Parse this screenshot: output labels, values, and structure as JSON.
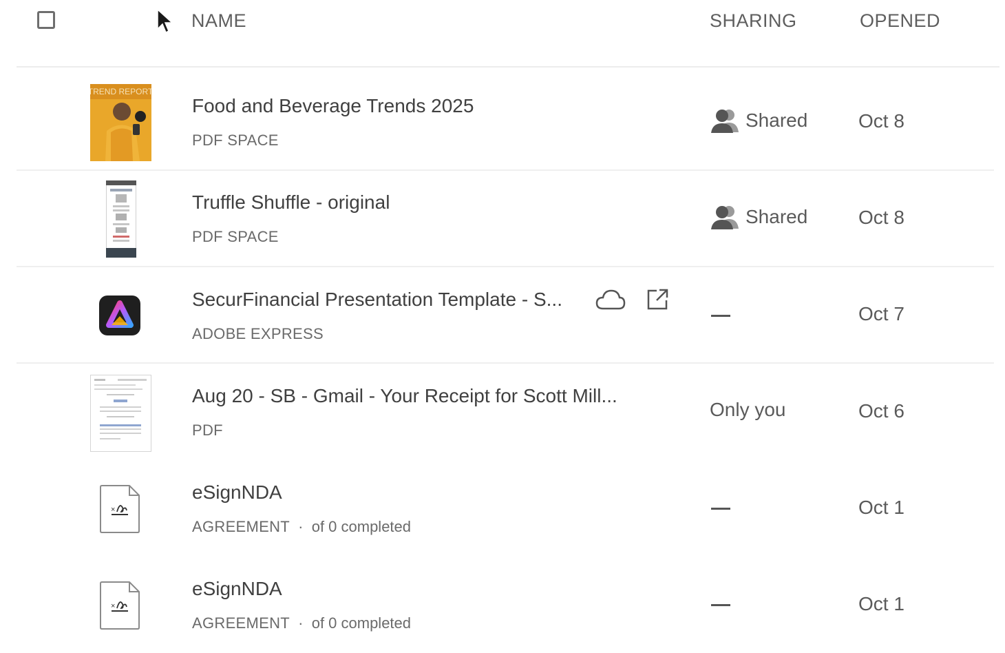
{
  "header": {
    "name": "NAME",
    "sharing": "SHARING",
    "opened": "OPENED"
  },
  "rows": [
    {
      "title": "Food and Beverage Trends 2025",
      "type": "PDF SPACE",
      "sharing": "Shared",
      "opened": "Oct 8",
      "thumb_text": "TREND REPORT",
      "thumb_icon": "magazine-cover-thumbnail"
    },
    {
      "title": "Truffle Shuffle - original",
      "type": "PDF SPACE",
      "sharing": "Shared",
      "opened": "Oct 8",
      "thumb_icon": "document-long-thumbnail"
    },
    {
      "title": "SecurFinancial Presentation Template - S...",
      "type": "ADOBE EXPRESS",
      "sharing": "—",
      "opened": "Oct 7",
      "thumb_icon": "adobe-express-icon"
    },
    {
      "title": "Aug 20 - SB - Gmail - Your Receipt for Scott Mill...",
      "type": "PDF",
      "sharing": "Only you",
      "opened": "Oct 6",
      "thumb_icon": "receipt-document-thumbnail"
    },
    {
      "title": "eSignNDA",
      "type": "AGREEMENT",
      "progress": "of 0 completed",
      "sharing": "—",
      "opened": "Oct 1",
      "thumb_icon": "esign-agreement-icon"
    },
    {
      "title": "eSignNDA",
      "type": "AGREEMENT",
      "progress": "of 0 completed",
      "sharing": "—",
      "opened": "Oct 1",
      "thumb_icon": "esign-agreement-icon"
    }
  ],
  "separator": "·",
  "colors": {
    "text": "#404040",
    "muted": "#6a6a6a",
    "divider": "#efefef"
  }
}
